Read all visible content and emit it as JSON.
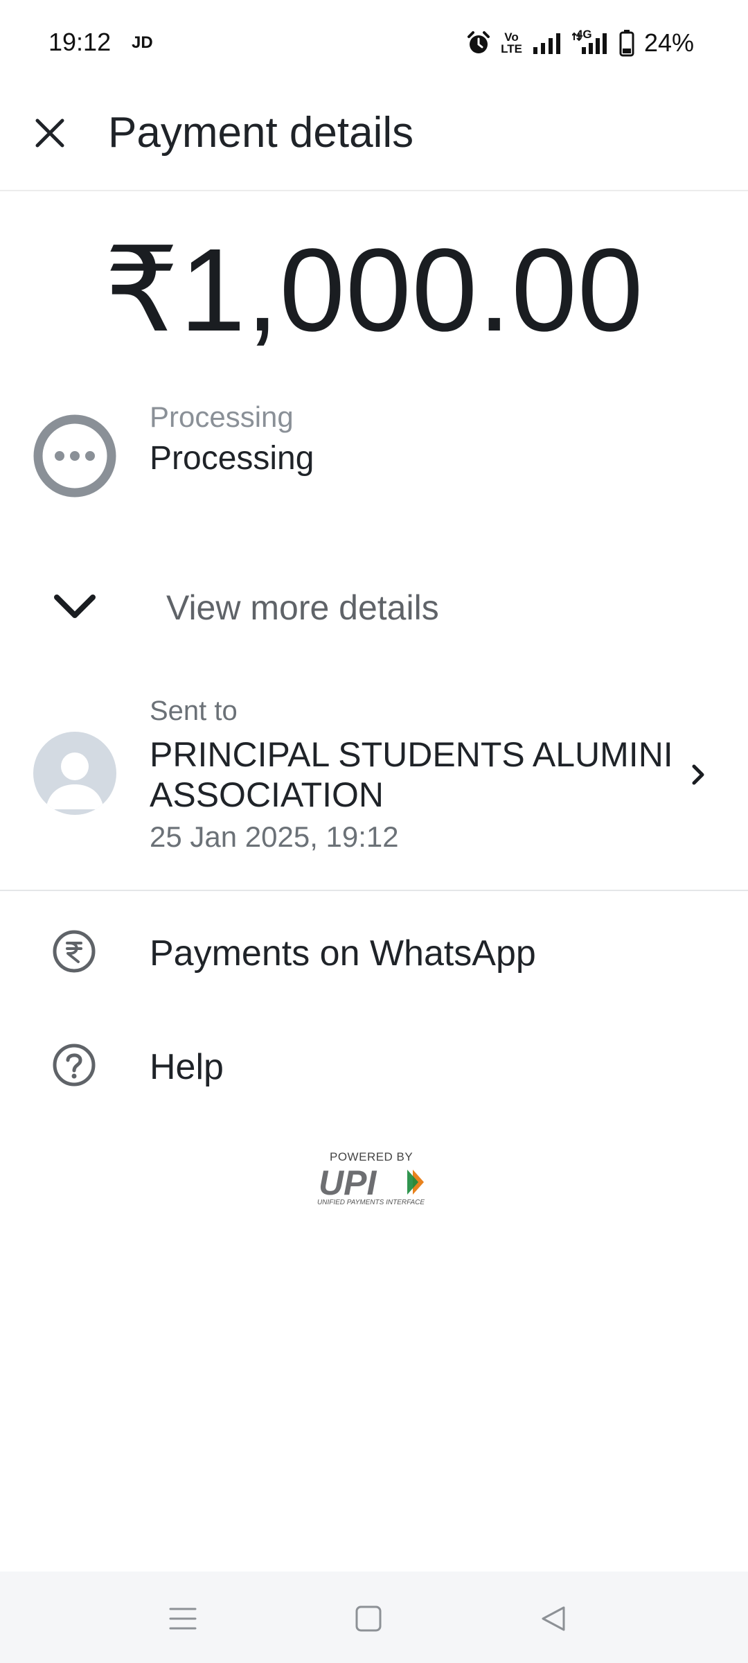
{
  "status_bar": {
    "time": "19:12",
    "carrier_tag": "JD",
    "volte_top": "Vo",
    "volte_bottom": "LTE",
    "network": "4G",
    "battery_percent": "24%"
  },
  "header": {
    "title": "Payment details",
    "close_icon": "close-icon"
  },
  "payment": {
    "amount": "₹1,000.00",
    "status_small": "Processing",
    "status_main": "Processing",
    "status_icon": "processing-dots-icon",
    "status_color": "#8a9097"
  },
  "view_more": {
    "label": "View more details",
    "icon": "chevron-down-icon"
  },
  "recipient": {
    "label": "Sent to",
    "name": "PRINCIPAL STUDENTS ALUMINI ASSOCIATION",
    "datetime": "25 Jan 2025, 19:12",
    "avatar_icon": "person-avatar-icon"
  },
  "list": {
    "items": [
      {
        "label": "Payments on WhatsApp",
        "icon": "rupee-icon"
      },
      {
        "label": "Help",
        "icon": "help-icon"
      }
    ]
  },
  "upi_logo": {
    "powered_by": "POWERED BY",
    "name": "UPI",
    "subtitle": "UNIFIED PAYMENTS INTERFACE"
  },
  "nav_bar": {
    "buttons": [
      "menu-icon",
      "home-icon",
      "back-icon"
    ]
  },
  "colors": {
    "text_primary": "#1f2328",
    "text_secondary": "#6b7177",
    "upi_orange": "#e8821e",
    "upi_green": "#1a8a3c"
  }
}
